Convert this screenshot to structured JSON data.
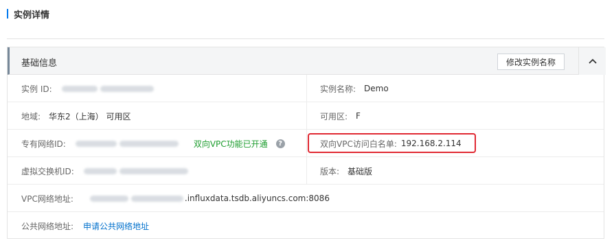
{
  "page": {
    "title": "实例详情"
  },
  "panel": {
    "title": "基础信息",
    "rename_button": "修改实例名称",
    "collapse_glyph": "⌃"
  },
  "rows": {
    "instance_id": {
      "label": "实例 ID:"
    },
    "instance_name": {
      "label": "实例名称:",
      "value": "Demo"
    },
    "region": {
      "label": "地域:",
      "value": "华东2（上海） 可用区"
    },
    "zone": {
      "label": "可用区:",
      "value": "F"
    },
    "vpc_id": {
      "label": "专有网络ID:",
      "status": "双向VPC功能已开通",
      "help": "?"
    },
    "vpc_whitelist": {
      "label": "双向VPC访问白名单:",
      "value": "192.168.2.114"
    },
    "vswitch_id": {
      "label": "虚拟交换机ID:"
    },
    "version": {
      "label": "版本:",
      "value": "基础版"
    },
    "vpc_address": {
      "label": "VPC网络地址:",
      "value_suffix": ".influxdata.tsdb.aliyuncs.com:8086"
    },
    "public_address": {
      "label": "公共网络地址:",
      "link": "申请公共网络地址"
    }
  },
  "colors": {
    "accent": "#0077ee",
    "status_green": "#1e9d2f",
    "link": "#0070cc",
    "highlight_red": "#e02731"
  }
}
